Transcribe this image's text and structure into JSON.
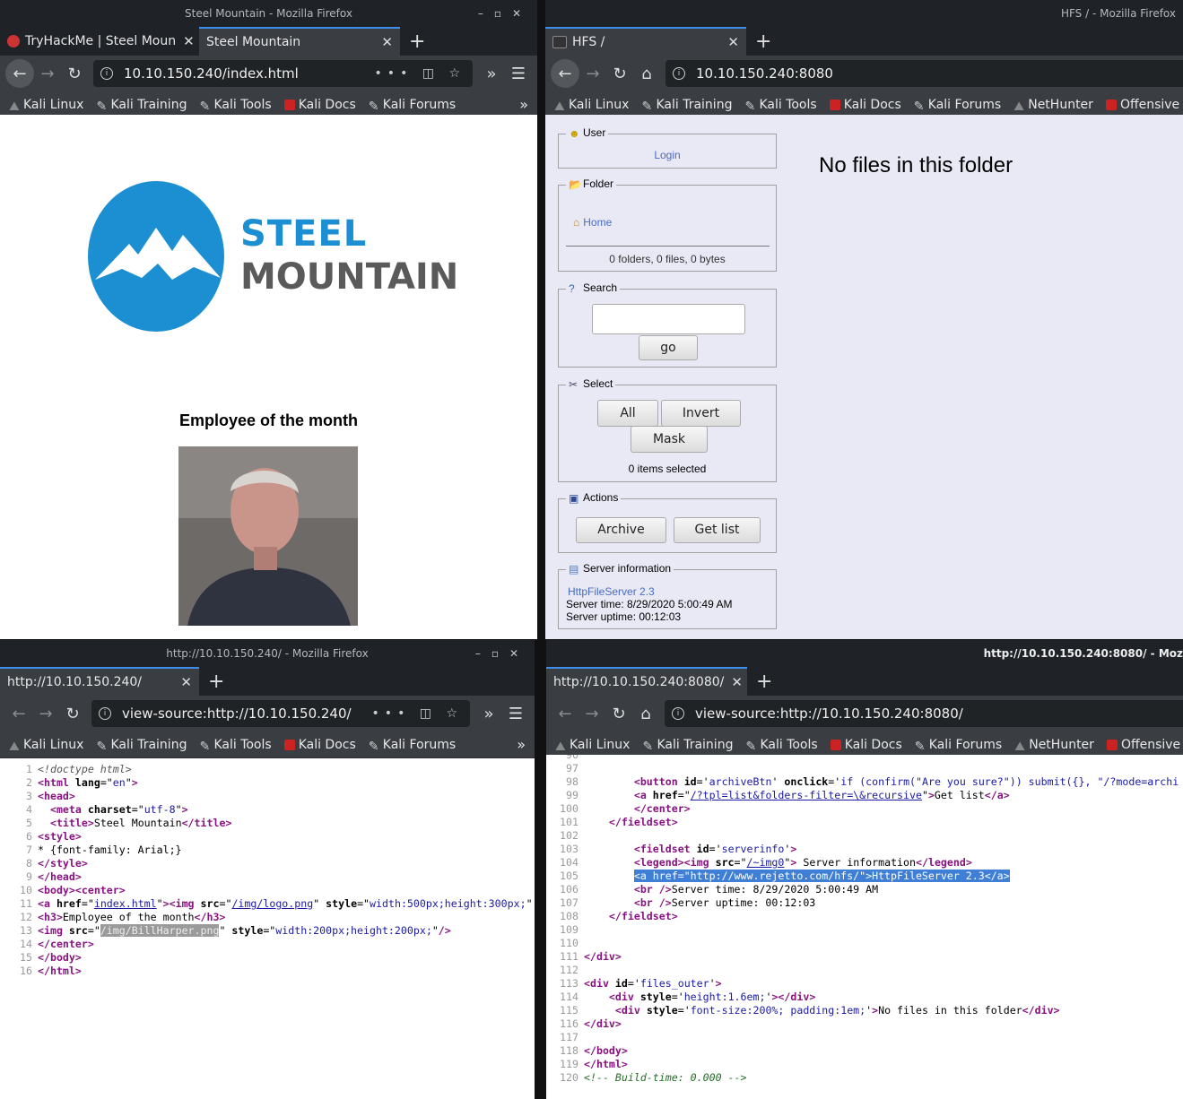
{
  "windows": {
    "top_left": {
      "title": "Steel Mountain - Mozilla Firefox",
      "tabs": [
        {
          "label": "TryHackMe | Steel Moun"
        },
        {
          "label": "Steel Mountain"
        }
      ],
      "url": "10.10.150.240/index.html",
      "bookmarks": [
        "Kali Linux",
        "Kali Training",
        "Kali Tools",
        "Kali Docs",
        "Kali Forums"
      ],
      "page": {
        "logo_line1": "STEEL",
        "logo_line2": "MOUNTAIN",
        "heading": "Employee of the month"
      }
    },
    "top_right": {
      "title": "HFS / - Mozilla Firefox",
      "tabs": [
        {
          "label": "HFS /"
        }
      ],
      "url": "10.10.150.240:8080",
      "bookmarks": [
        "Kali Linux",
        "Kali Training",
        "Kali Tools",
        "Kali Docs",
        "Kali Forums",
        "NetHunter",
        "Offensive"
      ],
      "hfs": {
        "user_legend": "User",
        "login": "Login",
        "folder_legend": "Folder",
        "home": "Home",
        "folder_stats": "0 folders, 0 files, 0 bytes",
        "search_legend": "Search",
        "go": "go",
        "select_legend": "Select",
        "all": "All",
        "invert": "Invert",
        "mask": "Mask",
        "selected": "0 items selected",
        "actions_legend": "Actions",
        "archive": "Archive",
        "get_list": "Get list",
        "server_legend": "Server information",
        "server_link": "HttpFileServer 2.3",
        "server_time": "Server time: 8/29/2020 5:00:49 AM",
        "server_uptime": "Server uptime: 00:12:03",
        "empty_message": "No files in this folder"
      }
    },
    "bottom_left": {
      "title": "http://10.10.150.240/ - Mozilla Firefox",
      "tabs": [
        {
          "label": "http://10.10.150.240/"
        }
      ],
      "url": "view-source:http://10.10.150.240/",
      "bookmarks": [
        "Kali Linux",
        "Kali Training",
        "Kali Tools",
        "Kali Docs",
        "Kali Forums"
      ]
    },
    "bottom_right": {
      "title": "http://10.10.150.240:8080/ - Moz",
      "tabs": [
        {
          "label": "http://10.10.150.240:8080/"
        }
      ],
      "url": "view-source:http://10.10.150.240:8080/",
      "bookmarks": [
        "Kali Linux",
        "Kali Training",
        "Kali Tools",
        "Kali Docs",
        "Kali Forums",
        "NetHunter",
        "Offensive"
      ]
    }
  },
  "colors": {
    "firefox_chrome": "#3a3d42",
    "titlebar": "#1f2226",
    "hfs_bg": "#e9e9f6",
    "logo_blue": "#1b8fd2",
    "logo_gray": "#5a5a5a",
    "selection": "#3f7fd6"
  }
}
